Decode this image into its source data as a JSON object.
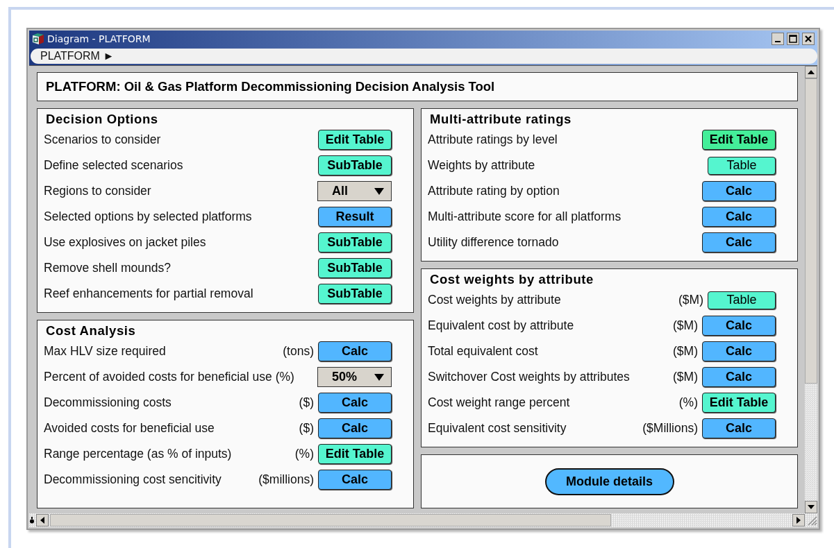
{
  "window": {
    "title": "Diagram - PLATFORM"
  },
  "breadcrumb": "PLATFORM ►",
  "header": "PLATFORM: Oil & Gas Platform Decommissioning Decision Analysis Tool",
  "columns": [
    {
      "panels": [
        {
          "title": "Decision Options",
          "rows": [
            {
              "label": "Scenarios to consider",
              "control": {
                "kind": "button",
                "text": "Edit Table",
                "color": "#55f5cf"
              }
            },
            {
              "label": "Define selected scenarios",
              "control": {
                "kind": "button",
                "text": "SubTable",
                "color": "#55f5cf"
              }
            },
            {
              "label": "Regions to consider",
              "control": {
                "kind": "dropdown",
                "text": "All"
              }
            },
            {
              "label": "Selected options by selected platforms",
              "control": {
                "kind": "button",
                "text": "Result",
                "color": "#52b6ff"
              }
            },
            {
              "label": "Use explosives on jacket piles",
              "control": {
                "kind": "button",
                "text": "SubTable",
                "color": "#55f5cf"
              }
            },
            {
              "label": "Remove shell mounds?",
              "control": {
                "kind": "button",
                "text": "SubTable",
                "color": "#55f5cf"
              }
            },
            {
              "label": "Reef enhancements for partial removal",
              "control": {
                "kind": "button",
                "text": "SubTable",
                "color": "#55f5cf"
              }
            }
          ]
        },
        {
          "title": "Cost Analysis",
          "rows": [
            {
              "label": "Max HLV size required",
              "unit": "(tons)",
              "control": {
                "kind": "button",
                "text": "Calc",
                "color": "#52b6ff"
              }
            },
            {
              "label": "Percent of avoided costs for beneficial use (%)",
              "control": {
                "kind": "dropdown",
                "text": "50%"
              }
            },
            {
              "label": "Decommissioning costs",
              "unit": "($)",
              "control": {
                "kind": "button",
                "text": "Calc",
                "color": "#52b6ff"
              }
            },
            {
              "label": "Avoided costs for beneficial use",
              "unit": "($)",
              "control": {
                "kind": "button",
                "text": "Calc",
                "color": "#52b6ff"
              }
            },
            {
              "label": "Range percentage (as % of inputs)",
              "unit": "(%)",
              "control": {
                "kind": "button",
                "text": "Edit Table",
                "color": "#55f5cf"
              }
            },
            {
              "label": "Decommissioning cost sencitivity",
              "unit": "($millions)",
              "control": {
                "kind": "button",
                "text": "Calc",
                "color": "#52b6ff"
              }
            }
          ]
        }
      ]
    },
    {
      "panels": [
        {
          "title": "Multi-attribute ratings",
          "rows": [
            {
              "label": "Attribute ratings by level",
              "control": {
                "kind": "button",
                "text": "Edit Table",
                "color": "#44ee99"
              }
            },
            {
              "label": "Weights by attribute",
              "control": {
                "kind": "plain_button",
                "text": "Table",
                "color": "#55f5cf"
              }
            },
            {
              "label": "Attribute rating by option",
              "control": {
                "kind": "button",
                "text": "Calc",
                "color": "#52b6ff"
              }
            },
            {
              "label": "Multi-attribute score for all platforms",
              "control": {
                "kind": "button",
                "text": "Calc",
                "color": "#52b6ff"
              }
            },
            {
              "label": "Utility difference tornado",
              "control": {
                "kind": "button",
                "text": "Calc",
                "color": "#52b6ff"
              }
            }
          ]
        },
        {
          "title": "Cost weights by attribute",
          "rows": [
            {
              "label": "Cost weights by attribute",
              "unit": "($M)",
              "control": {
                "kind": "plain_button",
                "text": "Table",
                "color": "#55f5cf"
              }
            },
            {
              "label": "Equivalent cost by attribute",
              "unit": "($M)",
              "control": {
                "kind": "button",
                "text": "Calc",
                "color": "#52b6ff"
              }
            },
            {
              "label": "Total equivalent cost",
              "unit": "($M)",
              "control": {
                "kind": "button",
                "text": "Calc",
                "color": "#52b6ff"
              }
            },
            {
              "label": "Switchover Cost weights by attributes",
              "unit": "($M)",
              "control": {
                "kind": "button",
                "text": "Calc",
                "color": "#52b6ff"
              }
            },
            {
              "label": "Cost weight range percent",
              "unit": "(%)",
              "control": {
                "kind": "button",
                "text": "Edit Table",
                "color": "#55f5cf"
              }
            },
            {
              "label": "Equivalent cost sensitivity",
              "unit": "($Millions)",
              "control": {
                "kind": "button",
                "text": "Calc",
                "color": "#52b6ff"
              }
            }
          ]
        },
        {
          "action": "Module details"
        }
      ]
    }
  ]
}
